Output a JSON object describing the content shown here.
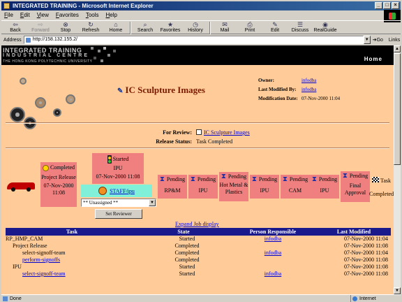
{
  "window": {
    "title": "INTEGRATED TRAINING - Microsoft Internet Explorer",
    "controls": [
      "_",
      "□",
      "×"
    ]
  },
  "menu": [
    "File",
    "Edit",
    "View",
    "Favorites",
    "Tools",
    "Help"
  ],
  "toolbar": {
    "back": "Back",
    "forward": "Forward",
    "stop": "Stop",
    "refresh": "Refresh",
    "home": "Home",
    "search": "Search",
    "favorites": "Favorites",
    "history": "History",
    "mail": "Mail",
    "print": "Print",
    "edit": "Edit",
    "discuss": "Discuss",
    "realguide": "RealGuide"
  },
  "address": {
    "label": "Address",
    "url": "http://158.132.155.2/",
    "go": "Go",
    "links": "Links"
  },
  "banner": {
    "logo_line1": "INTEGRATED TRAINING",
    "logo_line2": "INDUSTRIAL CENTRE",
    "logo_line3": "THE HONG KONG POLYTECHNIC UNIVERSITY",
    "home": "Home"
  },
  "page": {
    "title": "IC Sculpture Images",
    "owner_label": "Owner:",
    "owner": "infodba",
    "last_modified_by_label": "Last Modified By:",
    "last_modified_by": "infodba",
    "modification_date_label": "Modification Date:",
    "modification_date": "07-Nov-2000 11:04",
    "for_review_label": "For Review:",
    "for_review": "IC Sculpture Images",
    "release_status_label": "Release Status:",
    "release_status": "Task Completed"
  },
  "workflow": {
    "project_release": {
      "status": "Completed",
      "name": "Project Release",
      "date": "07-Nov-2000 11:08"
    },
    "ipu_started": {
      "status": "Started",
      "name": "IPU",
      "date": "07-Nov-2000 11:08"
    },
    "staff_link": "STAFF/ipu",
    "assignee": "** Unassigned **",
    "set_reviewer": "Set Reviewer",
    "pending_nodes": [
      {
        "status": "Pending",
        "name": "RP&M"
      },
      {
        "status": "Pending",
        "name": "IPU"
      },
      {
        "status": "Pending",
        "name": "Hot Metal & Plastics"
      },
      {
        "status": "Pending",
        "name": "IPU"
      },
      {
        "status": "Pending",
        "name": "CAM"
      },
      {
        "status": "Pending",
        "name": "IPU"
      },
      {
        "status": "Pending",
        "name": "Final Approval"
      }
    ],
    "end_task": {
      "label": "Task",
      "status": "Completed"
    },
    "expand_link": "Expand Job display"
  },
  "table": {
    "headers": [
      "Task",
      "State",
      "Person Responsible",
      "Last Modified"
    ],
    "rows": [
      {
        "task": "RP_HMP_CAM",
        "state": "Started",
        "person": "infodba",
        "modified": "07-Nov-2000 11:04"
      },
      {
        "task": "Project Release",
        "state": "Completed",
        "person": "",
        "modified": "07-Nov-2000 11:08"
      },
      {
        "task": "select-signoff-team",
        "state": "Completed",
        "person": "infodba",
        "modified": "07-Nov-2000 11:04"
      },
      {
        "task": "perform-signoffs",
        "state": "Completed",
        "person": "",
        "modified": "07-Nov-2000 11:08"
      },
      {
        "task": "IPU",
        "state": "Started",
        "person": "",
        "modified": "07-Nov-2000 11:08"
      },
      {
        "task": "select-signoff-team",
        "state": "Started",
        "person": "infodba",
        "modified": "07-Nov-2000 11:08"
      }
    ]
  },
  "status": {
    "text": "Done",
    "zone": "Internet"
  }
}
